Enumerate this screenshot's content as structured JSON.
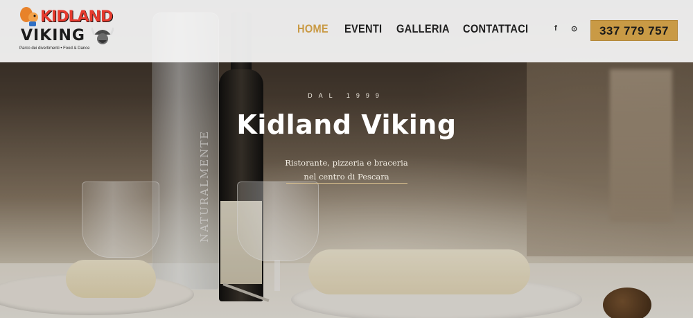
{
  "brand": {
    "logo_word_top": "KIDLAND",
    "logo_word_bottom": "VIKING",
    "logo_tagline": "Parco dei divertimenti • Food & Dance"
  },
  "nav": {
    "items": [
      {
        "label": "HOME",
        "active": true
      },
      {
        "label": "EVENTI",
        "active": false
      },
      {
        "label": "GALLERIA",
        "active": false
      },
      {
        "label": "CONTATTACI",
        "active": false
      }
    ]
  },
  "social": {
    "facebook_glyph": "f",
    "tripadvisor_glyph": "⊙"
  },
  "phone": {
    "label": "337 779 757"
  },
  "hero": {
    "eyebrow": "DAL 1999",
    "title": "Kidland Viking",
    "subtitle_line1": "Ristorante, pizzeria e braceria",
    "subtitle_line2": "nel centro di Pescara",
    "bottle_label": "NATURALMENTE"
  },
  "colors": {
    "accent": "#c99a45",
    "nav_text": "#1e1e1e",
    "header_bg": "#f8f8f8"
  },
  "icons": [
    "facebook-icon",
    "tripadvisor-icon"
  ]
}
